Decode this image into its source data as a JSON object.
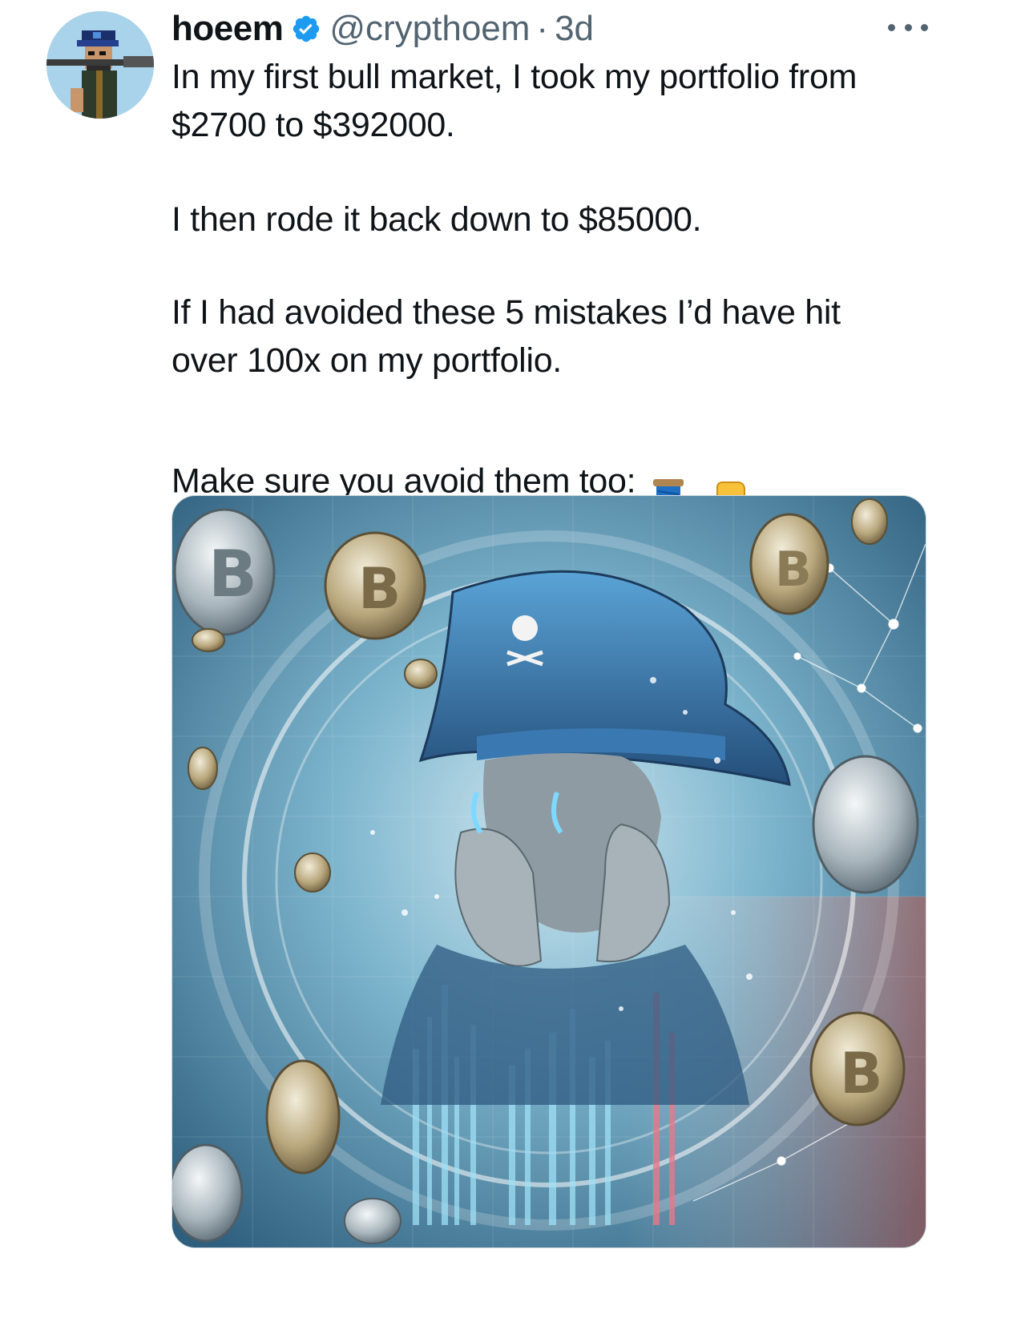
{
  "author": {
    "display_name": "hoeem",
    "handle": "@crypthoem",
    "separator": "·",
    "time": "3d",
    "verified": true,
    "verified_color": "#1d9bf0"
  },
  "tweet": {
    "para1": "In my first bull market, I took my portfolio from\n$2700 to $392000.",
    "para2": "I then rode it back down to $85000.",
    "para3": "If I had avoided these 5 mistakes I’d have hit\nover 100x on my portfolio.",
    "para4": "Make sure you avoid them too:",
    "emojis": [
      "spool-of-thread",
      "backhand-index-pointing-down"
    ]
  },
  "icons": {
    "more": "more-horizontal-icon",
    "verified": "verified-badge-icon"
  },
  "colors": {
    "text": "#0f1419",
    "secondary": "#536471",
    "accent": "#1d9bf0"
  },
  "media": {
    "description_icon": "pirate-crying-crypto-image"
  }
}
